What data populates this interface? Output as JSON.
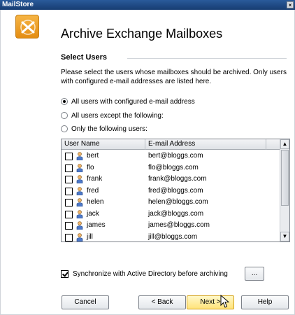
{
  "window": {
    "title": "MailStore"
  },
  "wizard": {
    "heading": "Archive Exchange Mailboxes",
    "section_title": "Select Users",
    "description": "Please select the users whose mailboxes should be archived. Only users with configured e-mail addresses are listed here."
  },
  "options": {
    "all_configured": "All users with configured e-mail address",
    "all_except": "All users except the following:",
    "only_following": "Only the following users:",
    "selected": "all_configured"
  },
  "table": {
    "headers": [
      "User Name",
      "E-mail Address"
    ],
    "rows": [
      {
        "name": "bert",
        "email": "bert@bloggs.com"
      },
      {
        "name": "flo",
        "email": "flo@bloggs.com"
      },
      {
        "name": "frank",
        "email": "frank@bloggs.com"
      },
      {
        "name": "fred",
        "email": "fred@bloggs.com"
      },
      {
        "name": "helen",
        "email": "helen@bloggs.com"
      },
      {
        "name": "jack",
        "email": "jack@bloggs.com"
      },
      {
        "name": "james",
        "email": "james@bloggs.com"
      },
      {
        "name": "jill",
        "email": "jill@bloggs.com"
      }
    ]
  },
  "sync": {
    "label": "Synchronize with Active Directory before archiving",
    "checked": true,
    "browse_label": "..."
  },
  "buttons": {
    "cancel": "Cancel",
    "back": "< Back",
    "next": "Next >",
    "help": "Help"
  },
  "colors": {
    "titlebar": "#1f4d8a",
    "accent": "#ffe37a",
    "logo": "#f0a22b"
  }
}
